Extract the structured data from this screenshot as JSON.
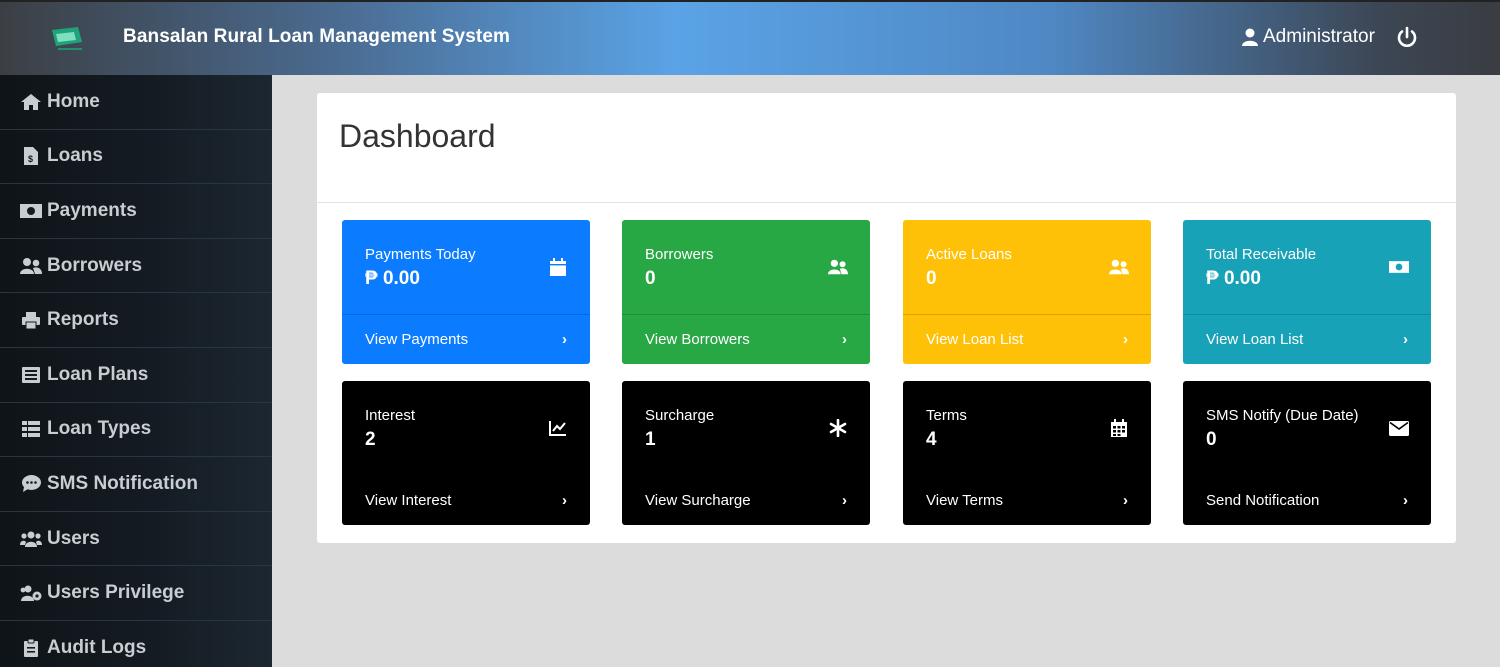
{
  "header": {
    "title": "Bansalan Rural Loan Management System",
    "user": "Administrator"
  },
  "sidebar": {
    "items": [
      {
        "label": "Home",
        "icon": "home-icon"
      },
      {
        "label": "Loans",
        "icon": "file-dollar-icon"
      },
      {
        "label": "Payments",
        "icon": "money-bill-icon"
      },
      {
        "label": "Borrowers",
        "icon": "user-friends-icon"
      },
      {
        "label": "Reports",
        "icon": "print-icon"
      },
      {
        "label": "Loan Plans",
        "icon": "list-alt-icon"
      },
      {
        "label": "Loan Types",
        "icon": "th-list-icon"
      },
      {
        "label": "SMS Notification",
        "icon": "comment-dots-icon"
      },
      {
        "label": "Users",
        "icon": "users-icon"
      },
      {
        "label": "Users Privilege",
        "icon": "users-cog-icon"
      },
      {
        "label": "Audit Logs",
        "icon": "clipboard-icon"
      }
    ]
  },
  "main": {
    "title": "Dashboard",
    "tiles": [
      {
        "label": "Payments Today",
        "value": "₱ 0.00",
        "link": "View Payments",
        "icon": "calendar-icon",
        "color": "#0b7bff"
      },
      {
        "label": "Borrowers",
        "value": "0",
        "link": "View Borrowers",
        "icon": "user-friends-icon",
        "color": "#28a745"
      },
      {
        "label": "Active Loans",
        "value": "0",
        "link": "View Loan List",
        "icon": "user-friends-icon",
        "color": "#ffc107"
      },
      {
        "label": "Total Receivable",
        "value": "₱ 0.00",
        "link": "View Loan List",
        "icon": "money-bill-icon",
        "color": "#17a2b8"
      },
      {
        "label": "Interest",
        "value": "2",
        "link": "View Interest",
        "icon": "chart-line-icon",
        "color": "#000000"
      },
      {
        "label": "Surcharge",
        "value": "1",
        "link": "View Surcharge",
        "icon": "asterisk-icon",
        "color": "#000000"
      },
      {
        "label": "Terms",
        "value": "4",
        "link": "View Terms",
        "icon": "calendar-alt-icon",
        "color": "#000000"
      },
      {
        "label": "SMS Notify (Due Date)",
        "value": "0",
        "link": "Send Notification",
        "icon": "envelope-icon",
        "color": "#000000"
      }
    ]
  }
}
